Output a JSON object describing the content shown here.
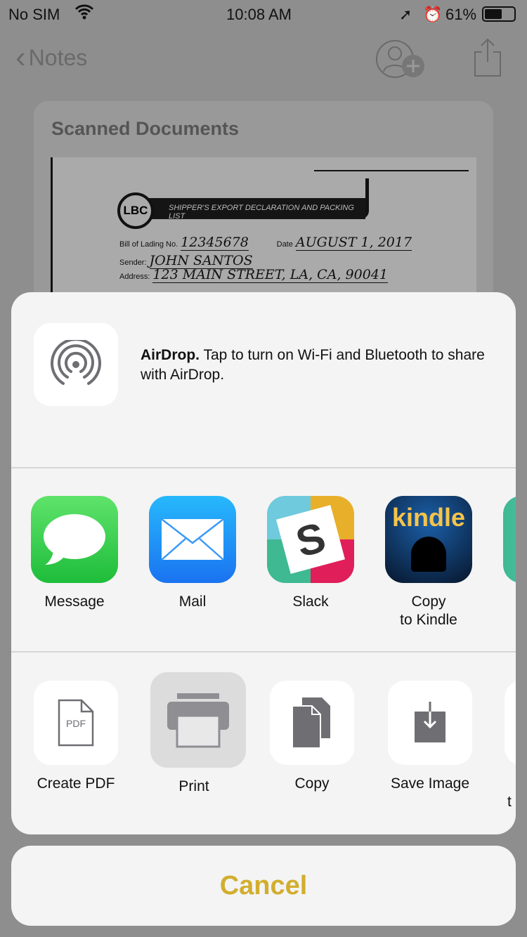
{
  "status": {
    "carrier": "No SIM",
    "time": "10:08 AM",
    "battery": "61%"
  },
  "nav": {
    "back_label": "Notes"
  },
  "note": {
    "title": "Scanned Documents",
    "document": {
      "logo": "LBC",
      "heading": "SHIPPER'S EXPORT DECLARATION AND PACKING LIST",
      "bill_label": "Bill of Lading No.",
      "bill_value": "12345678",
      "date_label": "Date",
      "date_value": "AUGUST 1, 2017",
      "sender_label": "Sender:",
      "sender_value": "JOHN SANTOS",
      "address_label": "Address:",
      "address_value": "123 MAIN STREET, LA, CA, 90041"
    }
  },
  "share": {
    "airdrop_title": "AirDrop.",
    "airdrop_text": " Tap to turn on Wi-Fi and Bluetooth to share with AirDrop.",
    "apps": [
      {
        "label": "Message"
      },
      {
        "label": "Mail"
      },
      {
        "label": "Slack"
      },
      {
        "label": "Copy\nto Kindle"
      }
    ],
    "actions": [
      {
        "label": "Create PDF"
      },
      {
        "label": "Print"
      },
      {
        "label": "Copy"
      },
      {
        "label": "Save Image"
      },
      {
        "label": "t"
      }
    ],
    "kindle_text": "kindle",
    "pdf_text": "PDF",
    "cancel_label": "Cancel"
  },
  "colors": {
    "cancel": "#d2ae2e",
    "message": "#3fd250",
    "mail": "#1e8ff5"
  }
}
